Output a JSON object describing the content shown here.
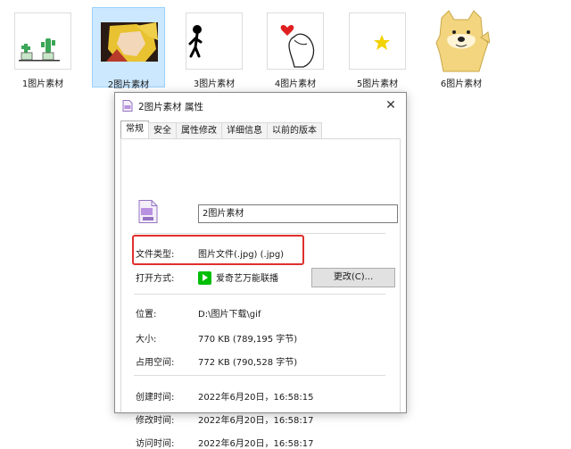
{
  "files": [
    {
      "label": "1图片素材",
      "icon": "cactus-thumbnail"
    },
    {
      "label": "2图片素材",
      "icon": "anime-girl-thumbnail"
    },
    {
      "label": "3图片素材",
      "icon": "stick-figure-thumbnail"
    },
    {
      "label": "4图片素材",
      "icon": "heart-hand-thumbnail"
    },
    {
      "label": "5图片素材",
      "icon": "star-thumbnail"
    },
    {
      "label": "6图片素材",
      "icon": "doge-thumbnail"
    }
  ],
  "dialog": {
    "title": "2图片素材 属性",
    "close": "✕",
    "tabs": [
      "常规",
      "安全",
      "属性修改",
      "详细信息",
      "以前的版本"
    ],
    "file_name": "2图片素材",
    "file_icon": "jpg-file-icon",
    "rows": {
      "type_label": "文件类型:",
      "type_value": "图片文件(.jpg) (.jpg)",
      "open_label": "打开方式:",
      "open_value": "爱奇艺万能联播",
      "change_button": "更改(C)...",
      "location_label": "位置:",
      "location_value": "D:\\图片下载\\gif",
      "size_label": "大小:",
      "size_value": "770 KB (789,195 字节)",
      "disk_label": "占用空间:",
      "disk_value": "772 KB (790,528 字节)",
      "created_label": "创建时间:",
      "created_value": "2022年6月20日，16:58:15",
      "modified_label": "修改时间:",
      "modified_value": "2022年6月20日，16:58:17",
      "accessed_label": "访问时间:",
      "accessed_value": "2022年6月20日，16:58:17"
    }
  },
  "colors": {
    "selection": "#cce8ff",
    "highlight_box": "#e0302c",
    "app_icon": "#00be06"
  }
}
